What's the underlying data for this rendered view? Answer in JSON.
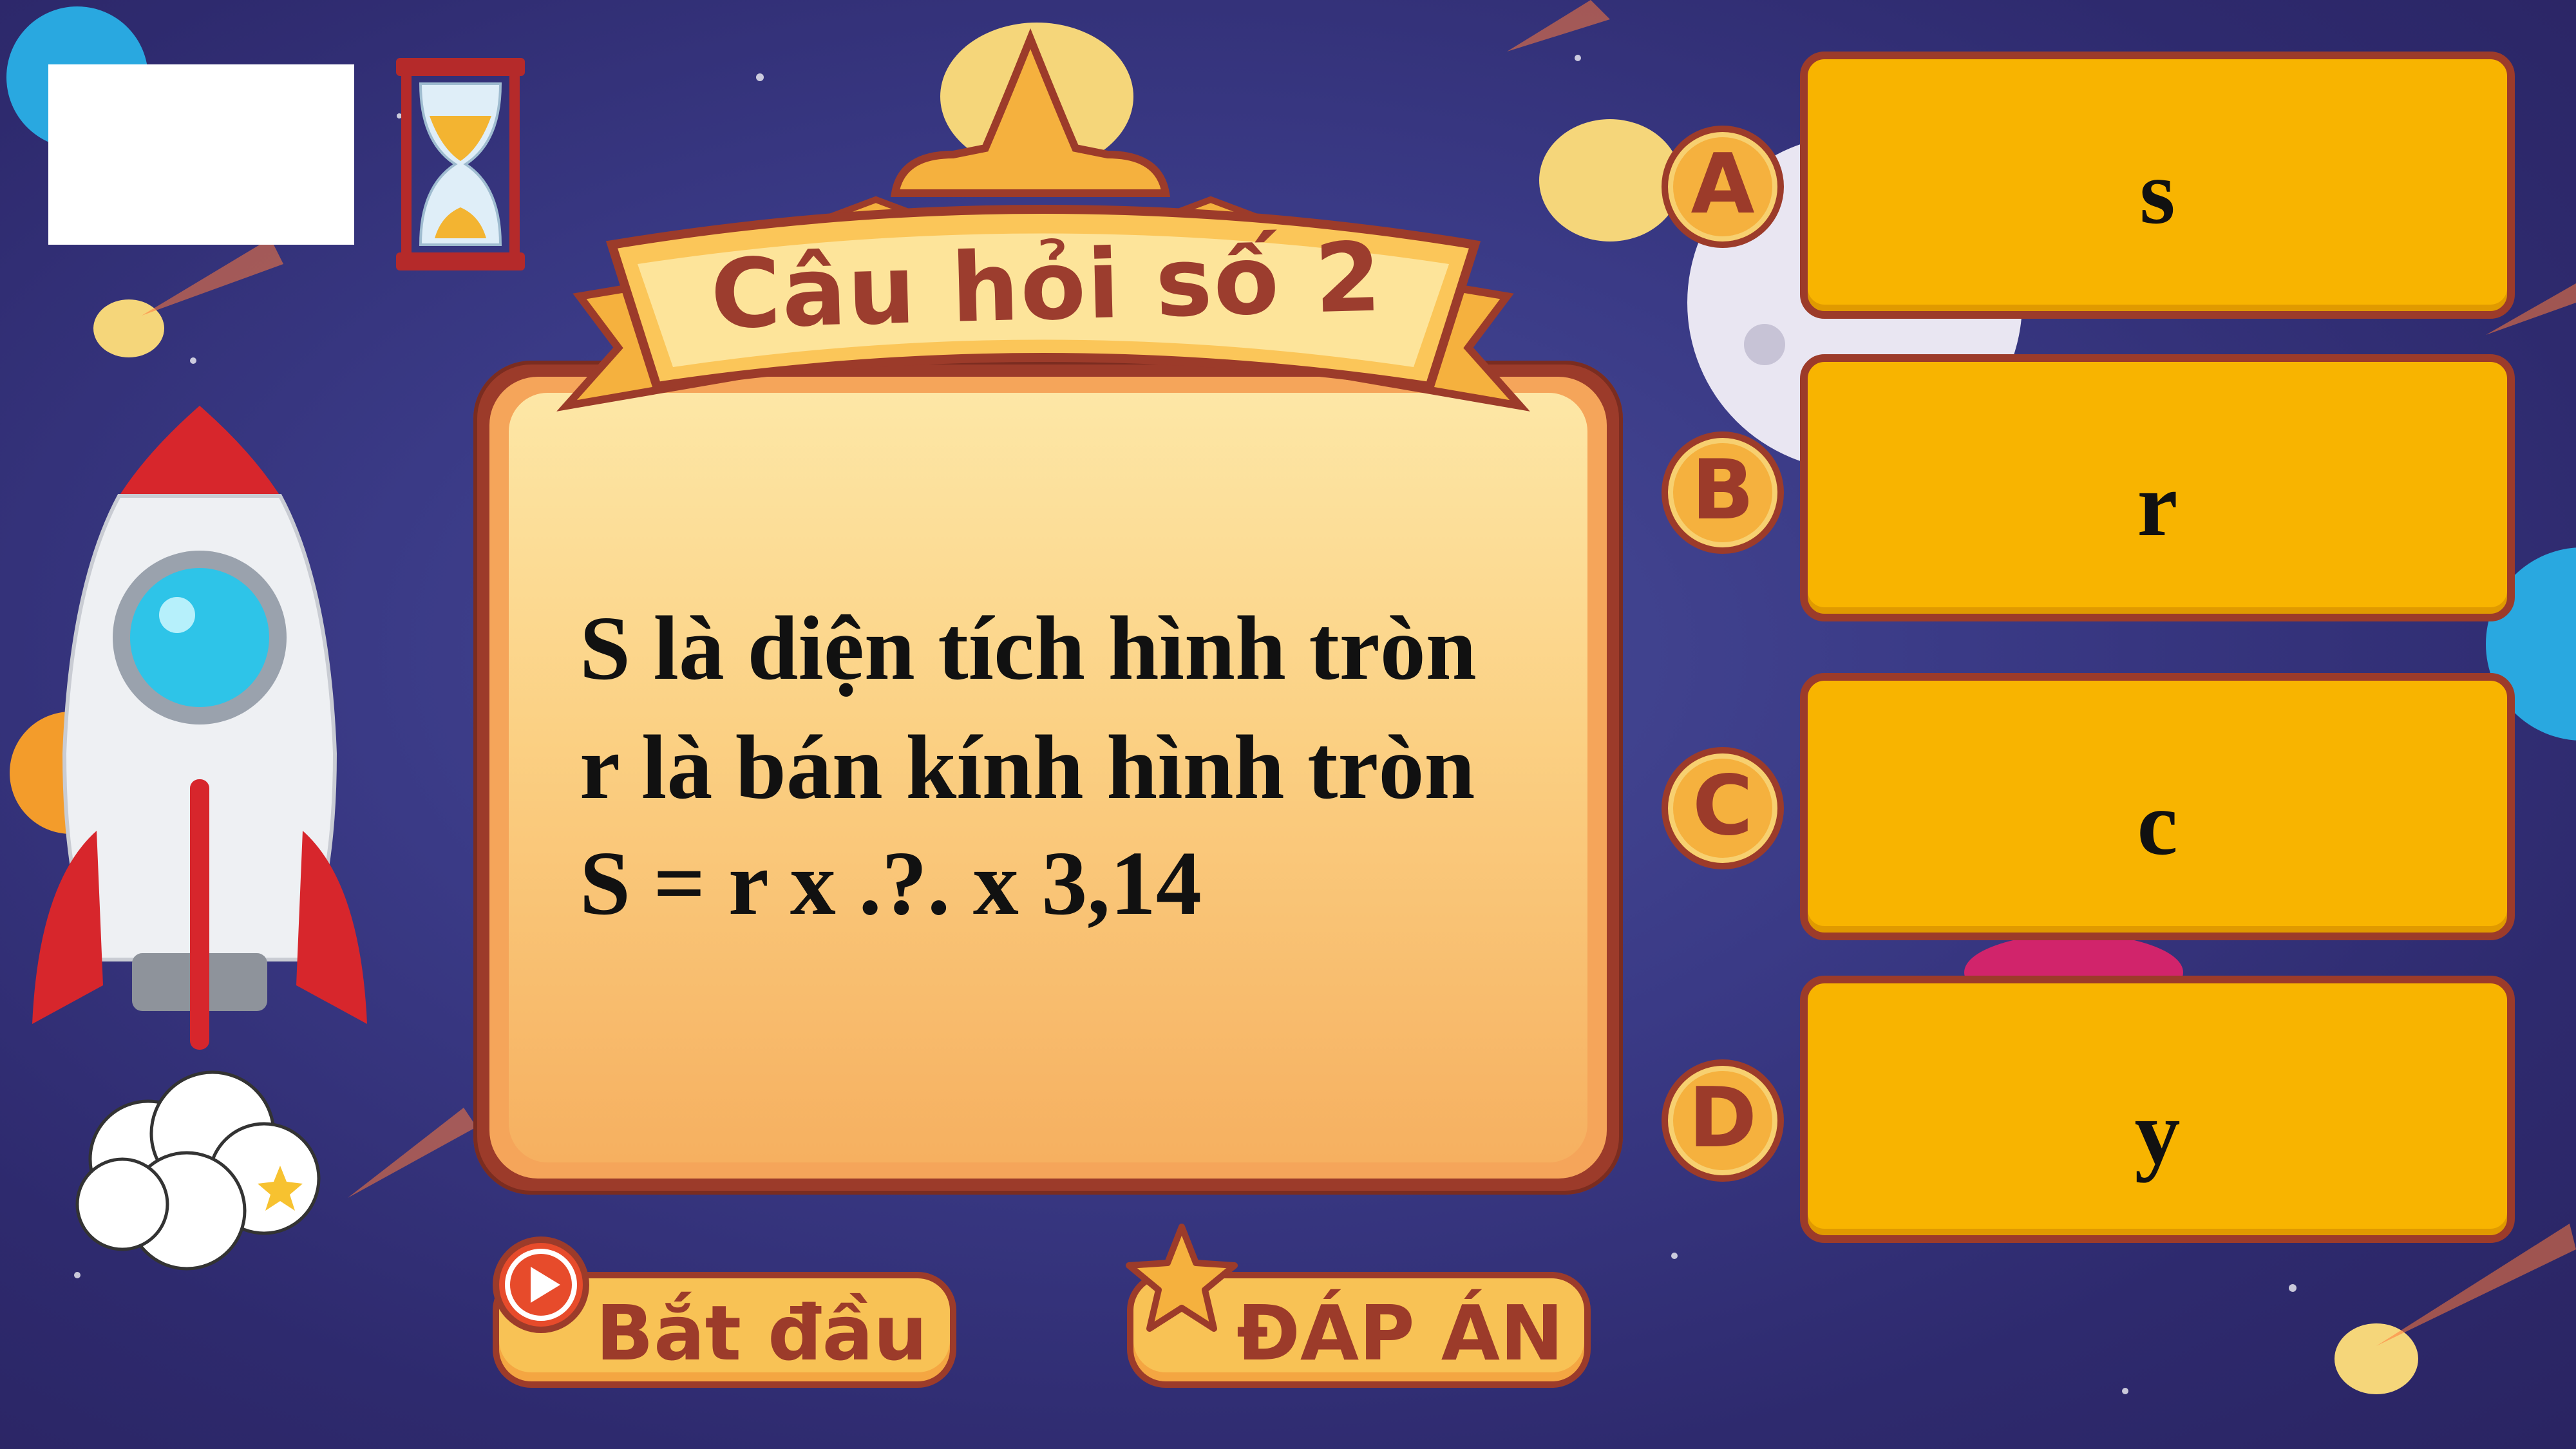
{
  "question": {
    "title": "Câu hỏi số 2",
    "lines": [
      "S là diện tích hình tròn",
      "r là bán kính hình tròn",
      "S = r x .?. x 3,14"
    ]
  },
  "answers": [
    {
      "letter": "A",
      "text": "s"
    },
    {
      "letter": "B",
      "text": "r"
    },
    {
      "letter": "C",
      "text": "c"
    },
    {
      "letter": "D",
      "text": "y"
    }
  ],
  "buttons": {
    "start": "Bắt đầu",
    "answer": "ĐÁP ÁN"
  },
  "timer": {
    "display": "",
    "icon": "hourglass-icon"
  },
  "colors": {
    "background": "#35337a",
    "card": "#fbd083",
    "card_border": "#9c3b2a",
    "answer_box": "#f8b400",
    "title_text": "#9c3d2e"
  }
}
